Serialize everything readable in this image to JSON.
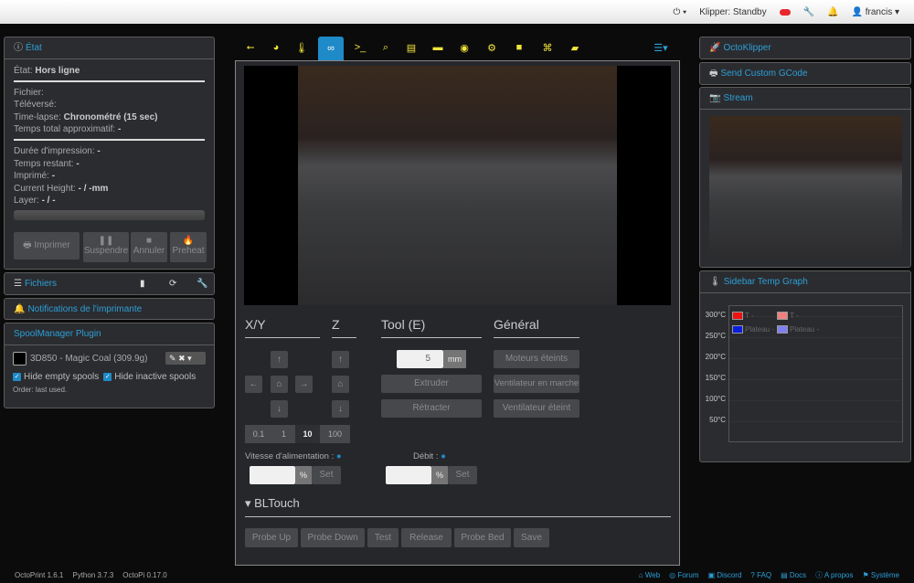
{
  "navbar": {
    "power_icon": "power-icon",
    "klipper_status": "Klipper: Standby",
    "user": "francis"
  },
  "state": {
    "title": "État",
    "state_label": "État:",
    "state_value": "Hors ligne",
    "file": "Fichier:",
    "uploaded": "Téléversé:",
    "timelapse_label": "Time-lapse:",
    "timelapse_value": "Chronométré (15 sec)",
    "total_time": "Temps total approximatif:",
    "total_time_value": "-",
    "print_time": "Durée d'impression:",
    "print_time_value": "-",
    "remaining": "Temps restant:",
    "remaining_value": "-",
    "printed": "Imprimé:",
    "printed_value": "-",
    "height": "Current Height:",
    "height_value": "- / -mm",
    "layer": "Layer:",
    "layer_value": "- / -",
    "progress": 0,
    "buttons": {
      "print": "Imprimer",
      "pause": "Suspendre",
      "cancel": "Annuler",
      "preheat": "Preheat"
    }
  },
  "files": {
    "title": "Fichiers"
  },
  "notifications": {
    "title": "Notifications de l'imprimante"
  },
  "spool": {
    "title": "SpoolManager Plugin",
    "spool": "3D850 - Magic Coal (309.9g)",
    "hide_empty": "Hide empty spools",
    "hide_inactive": "Hide inactive spools",
    "order": "Order: last used."
  },
  "tabs": [
    "usb",
    "gauge",
    "thermometer",
    "link",
    "terminal",
    "search",
    "clipboard",
    "bed",
    "palette",
    "cogs",
    "video",
    "bezier",
    "note"
  ],
  "control": {
    "xy": "X/Y",
    "z": "Z",
    "tool": "Tool (E)",
    "general": "Général",
    "steps": [
      "0.1",
      "1",
      "10",
      "100"
    ],
    "active_step": "10",
    "extrude_amount": "5",
    "unit": "mm",
    "extrude": "Extruder",
    "retract": "Rétracter",
    "motors_off": "Moteurs éteints",
    "fan_on": "Ventilateur en marche",
    "fan_off": "Ventilateur éteint",
    "feed_label": "Vitesse d'alimentation :",
    "flow_label": "Débit :",
    "percent": "%",
    "set": "Set",
    "bltouch": "BLTouch",
    "bl_buttons": [
      "Probe Up",
      "Probe Down",
      "Test",
      "Release",
      "Probe Bed",
      "Save"
    ]
  },
  "right": {
    "octoklipper": "OctoKlipper",
    "gcode": "Send Custom GCode",
    "stream": "Stream",
    "temp_graph": "Sidebar Temp Graph"
  },
  "chart_data": {
    "type": "line",
    "yticks": [
      "300°C",
      "250°C",
      "200°C",
      "150°C",
      "100°C",
      "50°C"
    ],
    "ylim": [
      0,
      300
    ],
    "legend": [
      {
        "name": "T -",
        "color": "#ee1111"
      },
      {
        "name": "T -",
        "color": "#f08080"
      },
      {
        "name": "Plateau -",
        "color": "#0a1ee0"
      },
      {
        "name": "Plateau -",
        "color": "#8080f0"
      }
    ],
    "series": []
  },
  "footer": {
    "versions": [
      "OctoPrint 1.6.1",
      "Python 3.7.3",
      "OctoPi 0.17.0"
    ],
    "links": [
      "Web",
      "Forum",
      "Discord",
      "FAQ",
      "Docs",
      "A propos",
      "Système"
    ]
  },
  "colors": {
    "accent": "#2c9fd6",
    "tab_icon": "#f2e53a",
    "active_tab": "#1f8ac8"
  }
}
